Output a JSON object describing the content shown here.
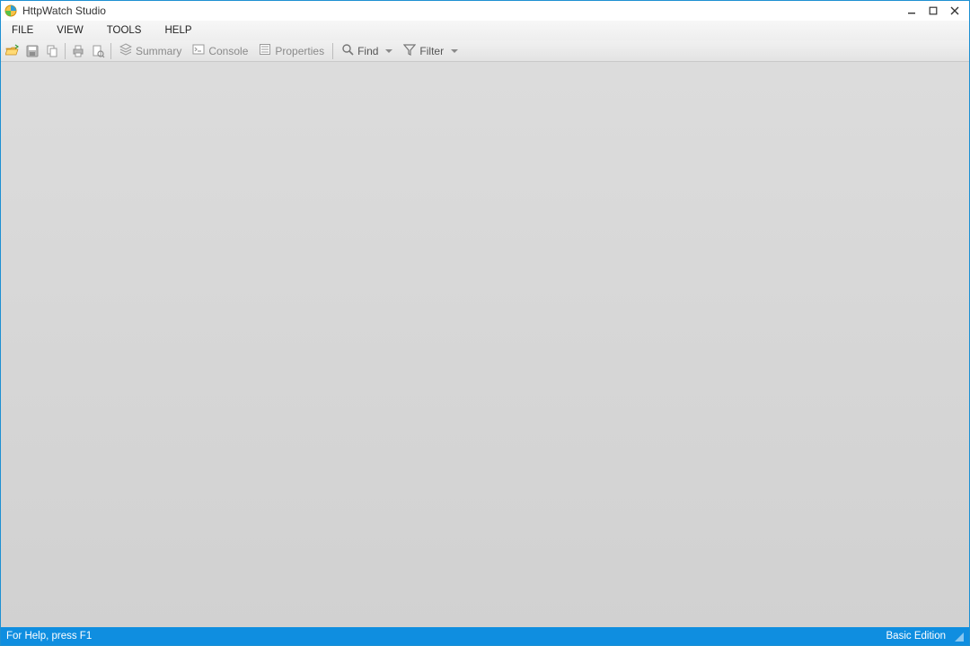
{
  "window": {
    "title": "HttpWatch Studio"
  },
  "menu": {
    "items": [
      "FILE",
      "VIEW",
      "TOOLS",
      "HELP"
    ]
  },
  "toolbar": {
    "summary": "Summary",
    "console": "Console",
    "properties": "Properties",
    "find": "Find",
    "filter": "Filter"
  },
  "statusbar": {
    "help": "For Help, press F1",
    "edition": "Basic Edition"
  },
  "colors": {
    "accent": "#0f8ee0",
    "border": "#1e90d2"
  }
}
